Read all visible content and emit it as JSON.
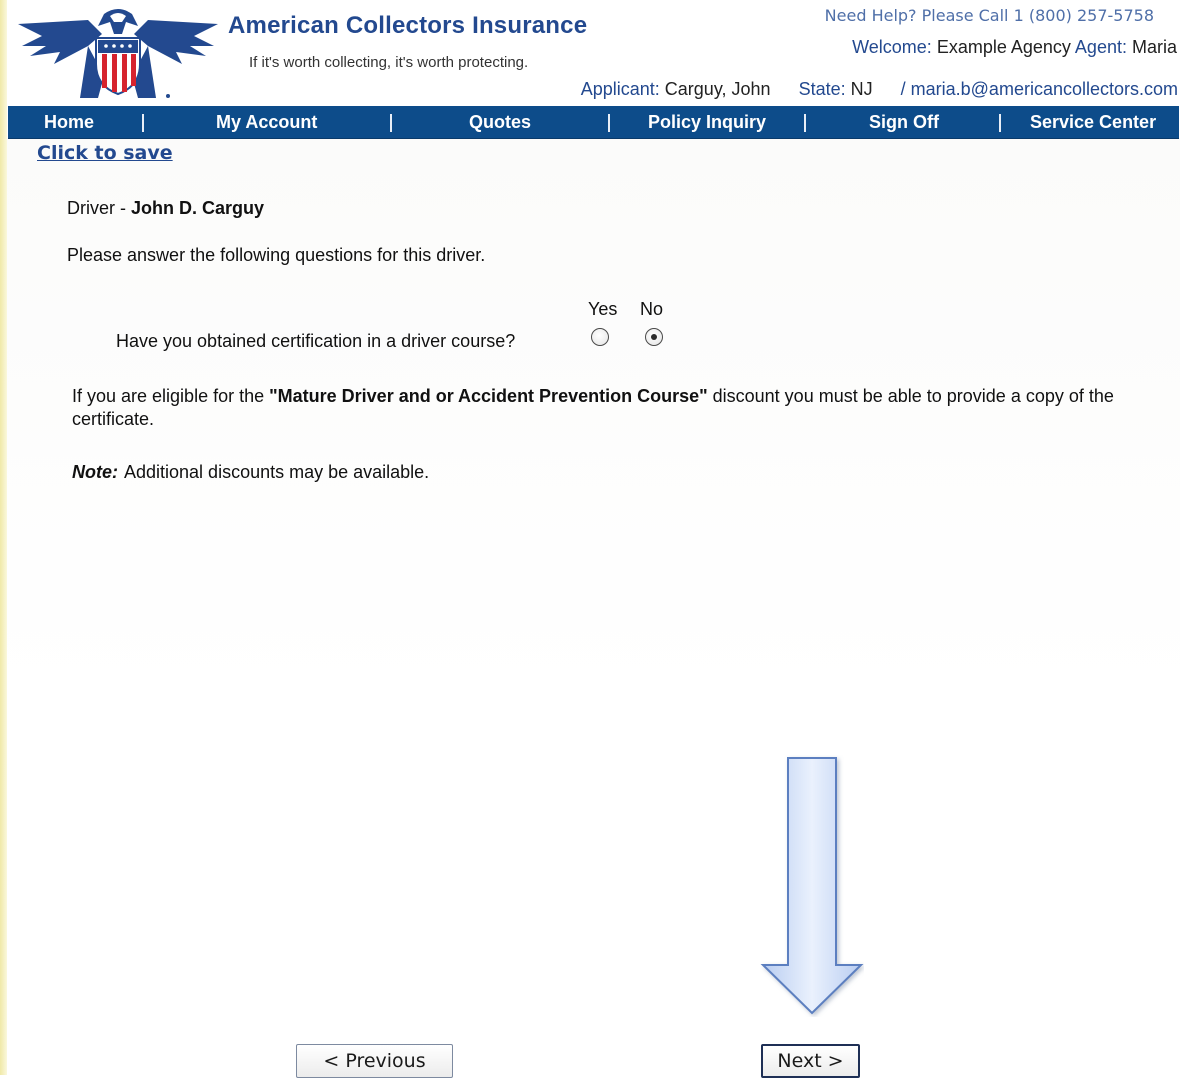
{
  "header": {
    "brand_title": "American Collectors Insurance",
    "tagline": "If it's worth collecting, it's worth protecting.",
    "help_text": "Need Help? Please Call 1 (800) 257-5758",
    "welcome_label": "Welcome:",
    "agency_name": "Example Agency",
    "agent_label": "Agent:",
    "agent_name": "Maria",
    "applicant_label": "Applicant:",
    "applicant_name": "Carguy, John",
    "state_label": "State:",
    "state_value": "NJ",
    "email": "/ maria.b@americancollectors.com"
  },
  "nav": {
    "items": [
      "Home",
      "My Account",
      "Quotes",
      "Policy Inquiry",
      "Sign Off",
      "Service Center"
    ],
    "separator": "|"
  },
  "save_link": "Click to save",
  "form": {
    "driver_label": "Driver - ",
    "driver_name": "John D. Carguy",
    "instructions": "Please answer the following questions for this driver.",
    "yes_label": "Yes",
    "no_label": "No",
    "question": "Have you obtained certification in a driver course?",
    "selected_answer": "No",
    "eligibility_pre": "If you are eligible for the ",
    "eligibility_bold": "\"Mature Driver and or Accident Prevention Course\"",
    "eligibility_post": " discount you must be able to provide a copy of the certificate.",
    "note_label": "Note:",
    "note_text": "Additional discounts may be available."
  },
  "buttons": {
    "previous": "< Previous",
    "next": "Next >"
  },
  "colors": {
    "nav_background": "#0d4c8a",
    "brand_blue": "#23498f",
    "logo_red": "#d6232e"
  }
}
